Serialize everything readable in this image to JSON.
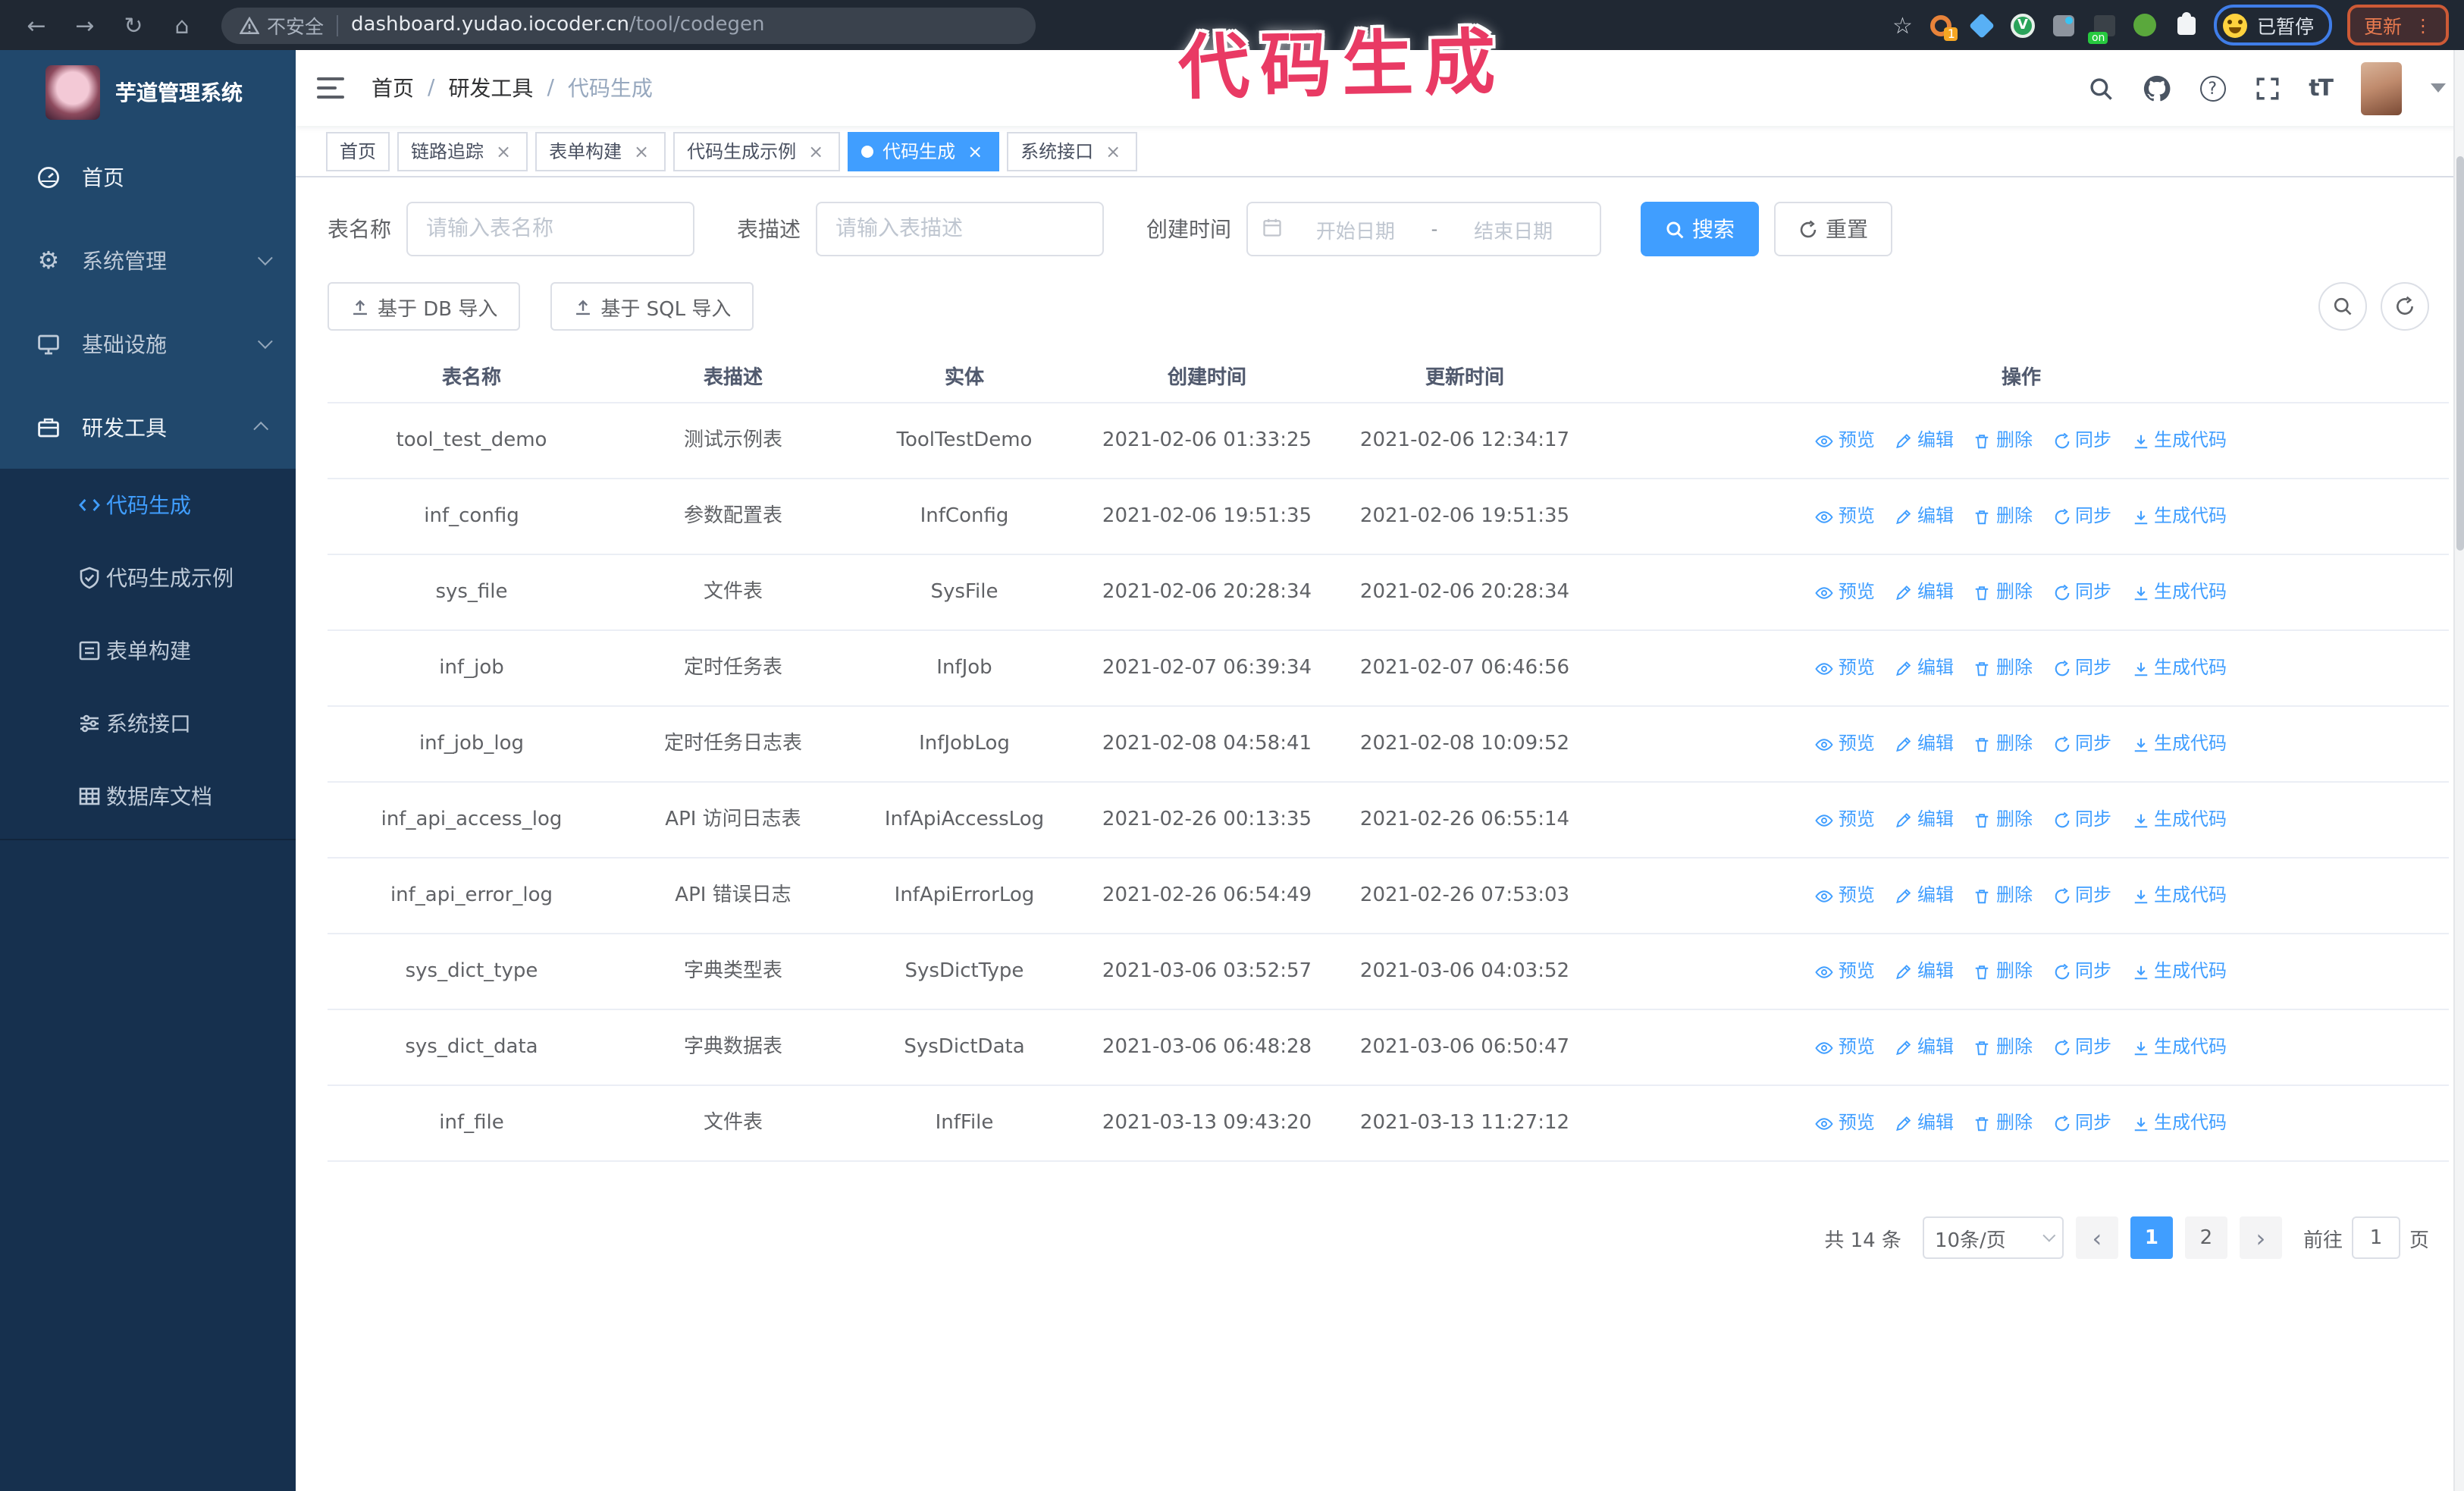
{
  "glyphs": {
    "back": "←",
    "forward": "→",
    "reload": "↻",
    "home": "⌂",
    "star": "☆",
    "overflow": "⋮",
    "prev": "‹",
    "next": "›",
    "close": "×",
    "font_size": "tT",
    "help": "?"
  },
  "browser": {
    "security": "不安全",
    "url_host": "dashboard.yudao.iocoder.cn",
    "url_path": "/tool/codegen",
    "ext_badge": "1",
    "ext_on": "on",
    "profile_status": "已暂停",
    "update_label": "更新"
  },
  "annotation": {
    "text": "代码生成"
  },
  "sidebar": {
    "title": "芋道管理系统",
    "items": [
      {
        "label": "首页",
        "icon": "dashboard-icon"
      },
      {
        "label": "系统管理",
        "icon": "gear-icon"
      },
      {
        "label": "基础设施",
        "icon": "monitor-icon"
      },
      {
        "label": "研发工具",
        "icon": "briefcase-icon"
      }
    ],
    "subitems": [
      {
        "label": "代码生成",
        "icon": "code-icon",
        "active": true
      },
      {
        "label": "代码生成示例",
        "icon": "shield-check-icon"
      },
      {
        "label": "表单构建",
        "icon": "form-icon"
      },
      {
        "label": "系统接口",
        "icon": "sliders-icon"
      },
      {
        "label": "数据库文档",
        "icon": "table-grid-icon"
      }
    ]
  },
  "breadcrumb": {
    "separator": "/",
    "items": [
      "首页",
      "研发工具",
      "代码生成"
    ]
  },
  "tabs": [
    {
      "label": "首页",
      "closable": false,
      "active": false
    },
    {
      "label": "链路追踪",
      "closable": true,
      "active": false
    },
    {
      "label": "表单构建",
      "closable": true,
      "active": false
    },
    {
      "label": "代码生成示例",
      "closable": true,
      "active": false
    },
    {
      "label": "代码生成",
      "closable": true,
      "active": true
    },
    {
      "label": "系统接口",
      "closable": true,
      "active": false
    }
  ],
  "filters": {
    "name_label": "表名称",
    "name_placeholder": "请输入表名称",
    "desc_label": "表描述",
    "desc_placeholder": "请输入表描述",
    "time_label": "创建时间",
    "start_placeholder": "开始日期",
    "range_separator": "-",
    "end_placeholder": "结束日期",
    "search_label": "搜索",
    "reset_label": "重置"
  },
  "toolbar": {
    "import_db": "基于 DB 导入",
    "import_sql": "基于 SQL 导入"
  },
  "table": {
    "columns": [
      "表名称",
      "表描述",
      "实体",
      "创建时间",
      "更新时间",
      "操作"
    ],
    "actions": [
      "预览",
      "编辑",
      "删除",
      "同步",
      "生成代码"
    ],
    "rows": [
      {
        "name": "tool_test_demo",
        "desc": "测试示例表",
        "entity": "ToolTestDemo",
        "created": "2021-02-06 01:33:25",
        "updated": "2021-02-06 12:34:17"
      },
      {
        "name": "inf_config",
        "desc": "参数配置表",
        "entity": "InfConfig",
        "created": "2021-02-06 19:51:35",
        "updated": "2021-02-06 19:51:35"
      },
      {
        "name": "sys_file",
        "desc": "文件表",
        "entity": "SysFile",
        "created": "2021-02-06 20:28:34",
        "updated": "2021-02-06 20:28:34"
      },
      {
        "name": "inf_job",
        "desc": "定时任务表",
        "entity": "InfJob",
        "created": "2021-02-07 06:39:34",
        "updated": "2021-02-07 06:46:56"
      },
      {
        "name": "inf_job_log",
        "desc": "定时任务日志表",
        "entity": "InfJobLog",
        "created": "2021-02-08 04:58:41",
        "updated": "2021-02-08 10:09:52"
      },
      {
        "name": "inf_api_access_log",
        "desc": "API 访问日志表",
        "entity": "InfApiAccessLog",
        "created": "2021-02-26 00:13:35",
        "updated": "2021-02-26 06:55:14"
      },
      {
        "name": "inf_api_error_log",
        "desc": "API 错误日志",
        "entity": "InfApiErrorLog",
        "created": "2021-02-26 06:54:49",
        "updated": "2021-02-26 07:53:03"
      },
      {
        "name": "sys_dict_type",
        "desc": "字典类型表",
        "entity": "SysDictType",
        "created": "2021-03-06 03:52:57",
        "updated": "2021-03-06 04:03:52"
      },
      {
        "name": "sys_dict_data",
        "desc": "字典数据表",
        "entity": "SysDictData",
        "created": "2021-03-06 06:48:28",
        "updated": "2021-03-06 06:50:47"
      },
      {
        "name": "inf_file",
        "desc": "文件表",
        "entity": "InfFile",
        "created": "2021-03-13 09:43:20",
        "updated": "2021-03-13 11:27:12"
      }
    ]
  },
  "pagination": {
    "total": "共 14 条",
    "page_size": "10条/页",
    "pages": [
      "1",
      "2"
    ],
    "active_page": "1",
    "goto_label": "前往",
    "goto_value": "1",
    "page_unit": "页"
  },
  "colors": {
    "accent": "#409eff",
    "annotation_pink": "#e93a64",
    "sidebar_bg": "#21486c",
    "submenu_bg": "#16304e",
    "browser_bar_bg": "#202833",
    "menu_text": "#bfcbd9"
  }
}
